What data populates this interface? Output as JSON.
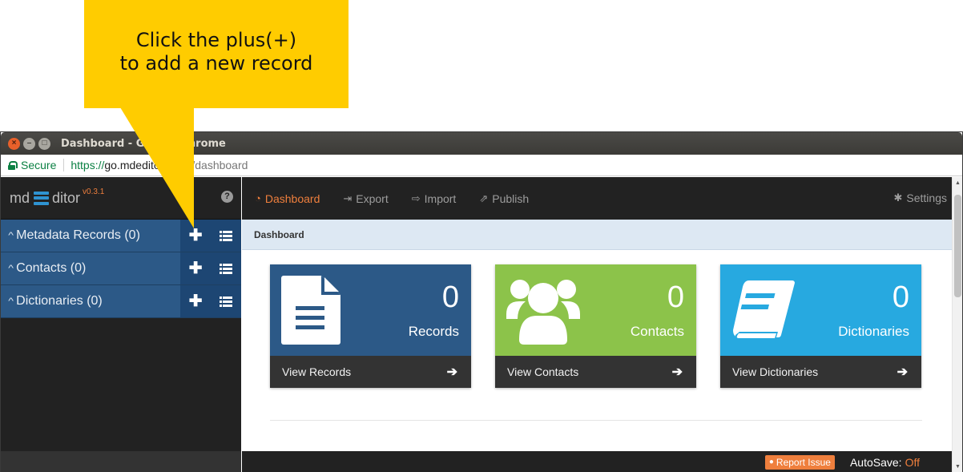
{
  "callout": {
    "text": "Click the plus(+)\nto add a new record"
  },
  "window": {
    "title": "Dashboard - Google Chrome"
  },
  "address": {
    "secure_label": "Secure",
    "scheme": "https://",
    "host": "go.mdeditor.org",
    "path": "/#/dashboard"
  },
  "brand": {
    "prefix": "md",
    "suffix": "ditor",
    "version": "v0.3.1"
  },
  "sidebar": {
    "items": [
      {
        "label": "Metadata Records (0)"
      },
      {
        "label": "Contacts (0)"
      },
      {
        "label": "Dictionaries (0)"
      }
    ]
  },
  "nav": {
    "items": [
      {
        "label": "Dashboard",
        "icon": "dashboard-icon"
      },
      {
        "label": "Export",
        "icon": "export-icon"
      },
      {
        "label": "Import",
        "icon": "import-icon"
      },
      {
        "label": "Publish",
        "icon": "publish-icon"
      }
    ],
    "settings": "Settings"
  },
  "breadcrumb": "Dashboard",
  "cards": [
    {
      "count": "0",
      "name": "Records",
      "link": "View Records",
      "color": "#2c5987",
      "icon": "document-icon"
    },
    {
      "count": "0",
      "name": "Contacts",
      "link": "View Contacts",
      "color": "#8cc34a",
      "icon": "users-icon"
    },
    {
      "count": "0",
      "name": "Dictionaries",
      "link": "View Dictionaries",
      "color": "#27a9e0",
      "icon": "book-icon"
    }
  ],
  "footer": {
    "report": "Report Issue",
    "autosave_label": "AutoSave:",
    "autosave_value": "Off"
  },
  "colors": {
    "accent": "#ef7f3d",
    "sidebar_item": "#2c5987",
    "callout": "#ffcc00"
  }
}
